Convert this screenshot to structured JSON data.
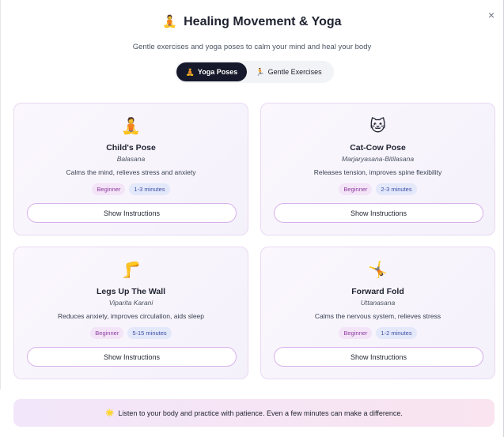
{
  "header": {
    "title_emoji": "🧘",
    "title": "Healing Movement & Yoga",
    "subtitle": "Gentle exercises and yoga poses to calm your mind and heal your body",
    "close_glyph": "×"
  },
  "tabs": [
    {
      "icon": "🧘",
      "label": "Yoga Poses",
      "active": true
    },
    {
      "icon": "🏃",
      "label": "Gentle Exercises",
      "active": false
    }
  ],
  "cards": [
    {
      "icon": "🧘",
      "title": "Child's Pose",
      "sanskrit": "Balasana",
      "description": "Calms the mind, relieves stress and anxiety",
      "level": "Beginner",
      "duration": "1-3 minutes",
      "button": "Show Instructions"
    },
    {
      "icon": "🐱",
      "title": "Cat-Cow Pose",
      "sanskrit": "Marjaryasana-Bitilasana",
      "description": "Releases tension, improves spine flexibility",
      "level": "Beginner",
      "duration": "2-3 minutes",
      "button": "Show Instructions"
    },
    {
      "icon": "🦵",
      "title": "Legs Up The Wall",
      "sanskrit": "Viparita Karani",
      "description": "Reduces anxiety, improves circulation, aids sleep",
      "level": "Beginner",
      "duration": "5-15 minutes",
      "button": "Show Instructions"
    },
    {
      "icon": "🤸",
      "title": "Forward Fold",
      "sanskrit": "Uttanasana",
      "description": "Calms the nervous system, relieves stress",
      "level": "Beginner",
      "duration": "1-2 minutes",
      "button": "Show Instructions"
    }
  ],
  "footer": {
    "icon": "🌟",
    "text": "Listen to your body and practice with patience. Even a few minutes can make a difference."
  },
  "colors": {
    "active_tab": "#15192b",
    "level_badge": "#f3e4f7",
    "duration_badge": "#e3e8fa",
    "button_border": "#d7b3ea"
  }
}
